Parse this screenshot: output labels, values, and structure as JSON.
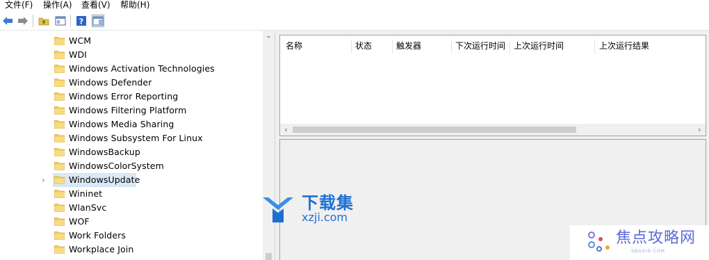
{
  "menu": {
    "file": "文件(F)",
    "action": "操作(A)",
    "view": "查看(V)",
    "help": "帮助(H)"
  },
  "toolbar": {
    "buttons": [
      "back-arrow-icon",
      "forward-arrow-icon",
      "up-folder-icon",
      "show-hide-tree-icon",
      "help-icon",
      "action-pane-icon"
    ]
  },
  "tree": {
    "items": [
      {
        "label": "WCM"
      },
      {
        "label": "WDI"
      },
      {
        "label": "Windows Activation Technologies"
      },
      {
        "label": "Windows Defender"
      },
      {
        "label": "Windows Error Reporting"
      },
      {
        "label": "Windows Filtering Platform"
      },
      {
        "label": "Windows Media Sharing"
      },
      {
        "label": "Windows Subsystem For Linux"
      },
      {
        "label": "WindowsBackup"
      },
      {
        "label": "WindowsColorSystem"
      },
      {
        "label": "WindowsUpdate",
        "selected": true,
        "expandable": true
      },
      {
        "label": "Wininet"
      },
      {
        "label": "WlanSvc"
      },
      {
        "label": "WOF"
      },
      {
        "label": "Work Folders"
      },
      {
        "label": "Workplace Join"
      }
    ]
  },
  "task_list": {
    "columns": [
      "名称",
      "状态",
      "触发器",
      "下次运行时间",
      "上次运行时间",
      "上次运行结果"
    ]
  },
  "watermarks": {
    "brand1_cn": "下载集",
    "brand1_url": "xzji.com",
    "brand2_cn": "焦点攻略网",
    "brand2_url": "SBGXID.COM"
  },
  "colors": {
    "selection": "#dbe9f7",
    "brand1": "#1f6fd1",
    "brand2": "#5b6bd8",
    "folder": "#f2cb5b"
  }
}
